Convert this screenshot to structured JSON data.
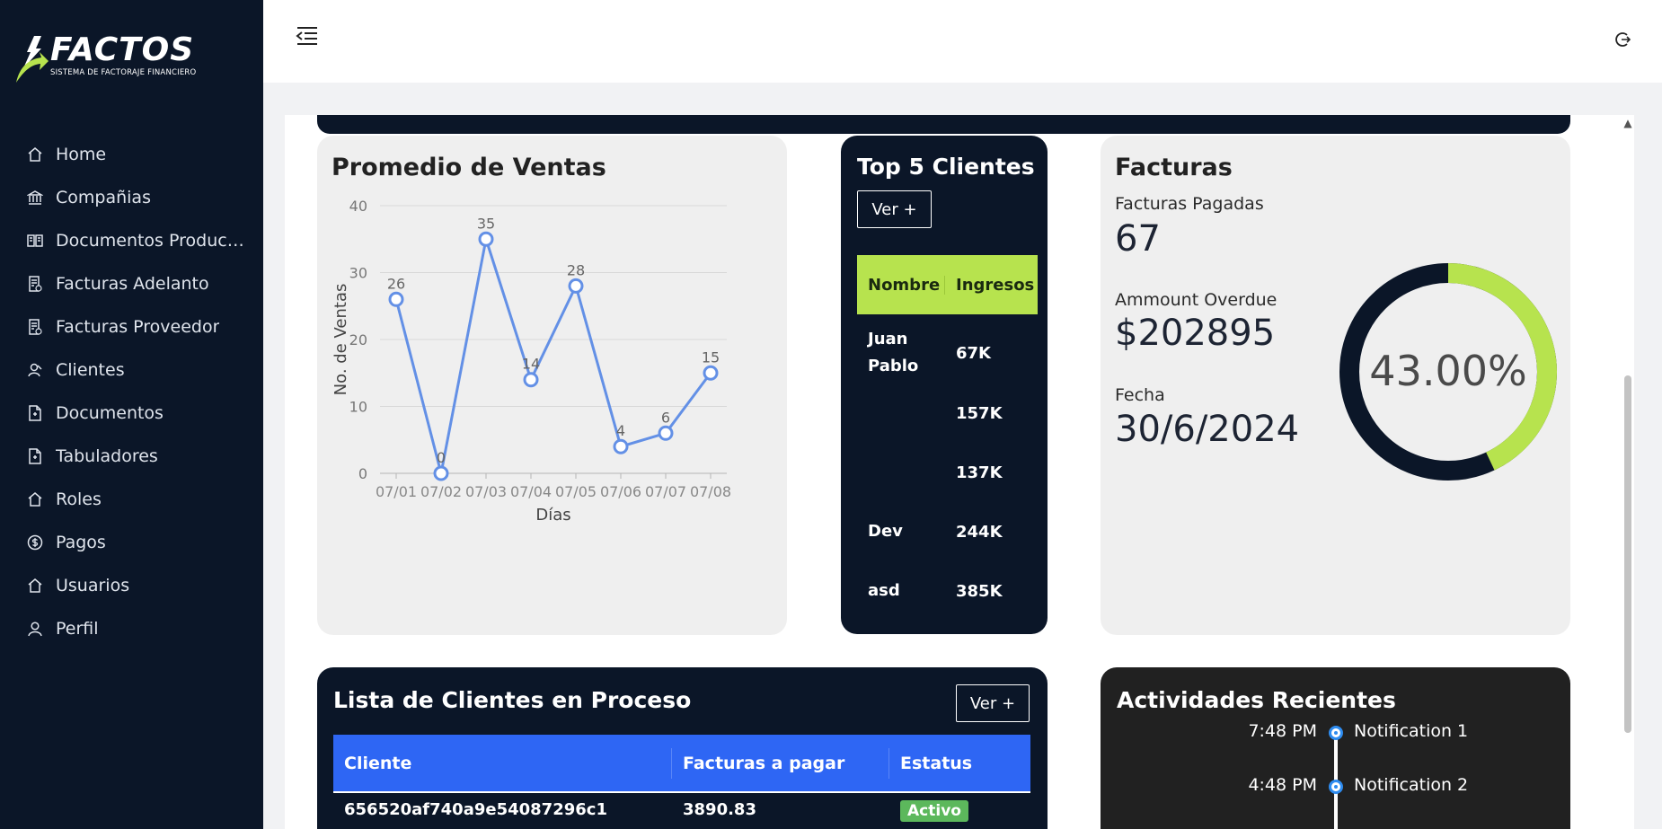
{
  "brand": {
    "name": "FACTOS",
    "subtitle": "SISTEMA DE FACTORAJE FINANCIERO",
    "accent": "#b7e34e"
  },
  "sidebar": {
    "items": [
      {
        "label": "Home",
        "icon": "home-icon"
      },
      {
        "label": "Compañias",
        "icon": "bank-icon"
      },
      {
        "label": "Documentos Productos",
        "icon": "book-icon"
      },
      {
        "label": "Facturas Adelanto",
        "icon": "invoice-icon"
      },
      {
        "label": "Facturas Proveedor",
        "icon": "invoice-icon"
      },
      {
        "label": "Clientes",
        "icon": "users-icon"
      },
      {
        "label": "Documentos",
        "icon": "document-icon"
      },
      {
        "label": "Tabuladores",
        "icon": "document-icon"
      },
      {
        "label": "Roles",
        "icon": "home-icon"
      },
      {
        "label": "Pagos",
        "icon": "coin-icon"
      },
      {
        "label": "Usuarios",
        "icon": "home-icon"
      },
      {
        "label": "Perfil",
        "icon": "user-icon"
      }
    ]
  },
  "promedio": {
    "title": "Promedio de Ventas",
    "chart_data": {
      "type": "line",
      "title": "Promedio de Ventas",
      "xlabel": "Días",
      "ylabel": "No. de Ventas",
      "categories": [
        "07/01",
        "07/02",
        "07/03",
        "07/04",
        "07/05",
        "07/06",
        "07/07",
        "07/08"
      ],
      "values": [
        26,
        0,
        35,
        14,
        28,
        4,
        6,
        15
      ],
      "ylim": [
        0,
        40
      ],
      "yticks": [
        0,
        10,
        20,
        30,
        40
      ],
      "grid": true,
      "color": "#6390e6"
    }
  },
  "top5": {
    "title": "Top 5 Clientes",
    "ver_label": "Ver +",
    "headers": [
      "Nombre",
      "Ingresos"
    ],
    "rows": [
      {
        "name": "Juan Pablo",
        "amount": "67K"
      },
      {
        "name": "",
        "amount": "157K"
      },
      {
        "name": "",
        "amount": "137K"
      },
      {
        "name": "Dev",
        "amount": "244K"
      },
      {
        "name": "asd",
        "amount": "385K"
      }
    ]
  },
  "facturas": {
    "title": "Facturas",
    "pagadas_label": "Facturas Pagadas",
    "pagadas_value": "67",
    "overdue_label": "Ammount Overdue",
    "overdue_value": "$202895",
    "fecha_label": "Fecha",
    "fecha_value": "30/6/2024",
    "donut_text": "43.00%",
    "donut_fraction": 0.43,
    "donut_colors": {
      "filled": "#b7e34e",
      "rest": "#0b1628"
    }
  },
  "lista": {
    "title": "Lista de Clientes en Proceso",
    "ver_label": "Ver +",
    "headers": [
      "Cliente",
      "Facturas a pagar",
      "Estatus"
    ],
    "rows": [
      {
        "cliente": "656520af740a9e54087296c1",
        "facturas": "3890.83",
        "estatus": "Activo"
      }
    ]
  },
  "actividades": {
    "title": "Actividades Recientes",
    "items": [
      {
        "time": "7:48 PM",
        "text": "Notification 1"
      },
      {
        "time": "4:48 PM",
        "text": "Notification 2"
      }
    ]
  }
}
